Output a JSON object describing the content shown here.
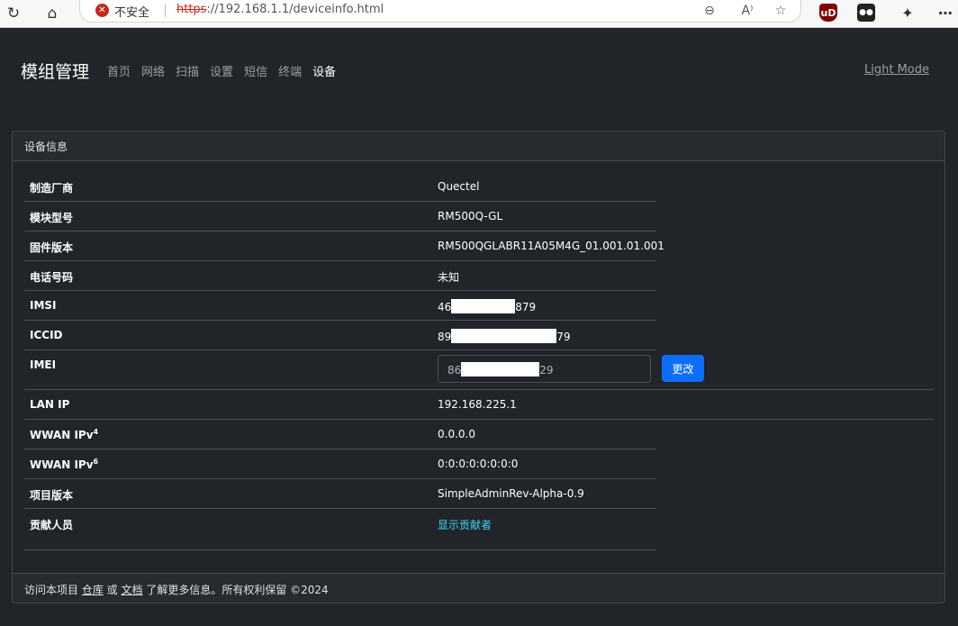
{
  "browser": {
    "insecure_label": "不安全",
    "url_scheme": "https",
    "url_rest": "://192.168.1.1/deviceinfo.html"
  },
  "nav": {
    "brand": "模组管理",
    "links": [
      "首页",
      "网络",
      "扫描",
      "设置",
      "短信",
      "终端",
      "设备"
    ],
    "active_index": 6,
    "light_mode": "Light Mode"
  },
  "card": {
    "title": "设备信息",
    "rows": [
      {
        "label": "制造厂商",
        "value": "Quectel"
      },
      {
        "label": "模块型号",
        "value": "RM500Q-GL"
      },
      {
        "label": "固件版本",
        "value": "RM500QGLABR11A05M4G_01.001.01.001"
      },
      {
        "label": "电话号码",
        "value": "未知"
      },
      {
        "label": "IMSI",
        "value_prefix": "46",
        "value_suffix": "879"
      },
      {
        "label": "ICCID",
        "value_prefix": "89",
        "value_suffix": "79"
      },
      {
        "label": "IMEI",
        "value_prefix": "86",
        "value_suffix": "29",
        "button": "更改"
      },
      {
        "label": "LAN IP",
        "value": "192.168.225.1"
      },
      {
        "label": "WWAN IPv",
        "label_sup": "4",
        "value": "0.0.0.0"
      },
      {
        "label": "WWAN IPv",
        "label_sup": "6",
        "value": "0:0:0:0:0:0:0:0"
      },
      {
        "label": "项目版本",
        "value": "SimpleAdminRev-Alpha-0.9"
      },
      {
        "label": "贡献人员",
        "value": "显示贡献者"
      }
    ],
    "footer": {
      "prefix": "访问本项目 ",
      "repo_link": "仓库",
      "middle": " 或 ",
      "docs_link": "文档",
      "suffix": " 了解更多信息。所有权利保留 ©2024"
    }
  },
  "colors": {
    "background": "#212529",
    "primary_button": "#0d6efd",
    "link": "#3dd5f3",
    "insecure_red": "#c42b1c"
  }
}
